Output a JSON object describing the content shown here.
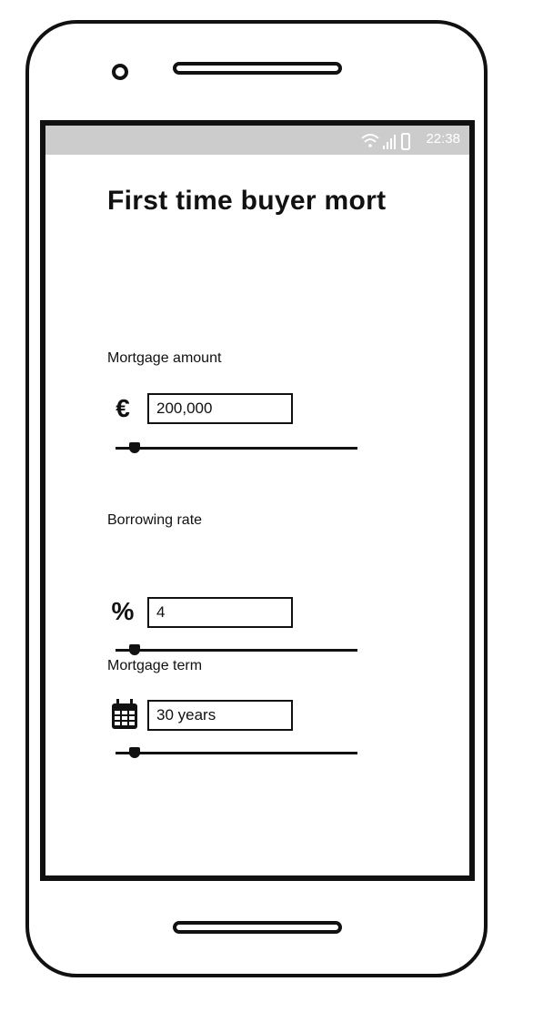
{
  "status_bar": {
    "time": "22:38",
    "icons": [
      "wifi-icon",
      "signal-icon",
      "battery-icon"
    ]
  },
  "title": "First time buyer mort",
  "mortgage_amount": {
    "label": "Mortgage amount",
    "icon": "euro-icon",
    "icon_glyph": "€",
    "value": "200,000",
    "slider_fraction": 0.08
  },
  "borrowing_rate": {
    "label": "Borrowing rate",
    "icon": "percent-icon",
    "icon_glyph": "%",
    "value": "4",
    "slider_fraction": 0.08
  },
  "mortgage_term": {
    "label": "Mortgage term",
    "icon": "calendar-icon",
    "value": "30 years",
    "slider_fraction": 0.08
  }
}
